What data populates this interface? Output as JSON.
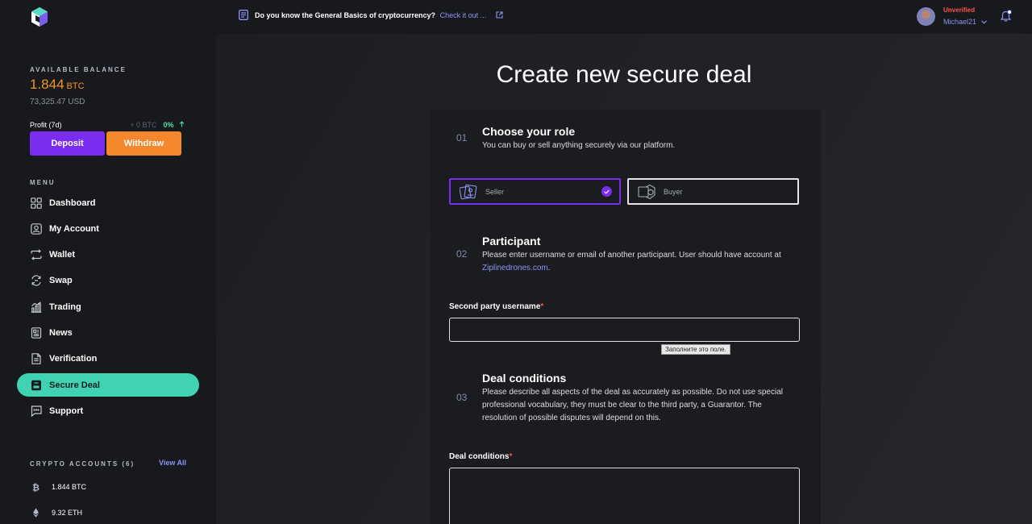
{
  "topbar": {
    "notice_text": "Do you know the General Basics of cryptocurrency?",
    "notice_link": "Check it out ...",
    "user_status": "Unverified",
    "username": "Michael21"
  },
  "sidebar": {
    "balance_label": "AVAILABLE BALANCE",
    "balance_amount": "1.844",
    "balance_unit": "BTC",
    "balance_usd": "73,325.47 USD",
    "profit_label": "Profit (7d)",
    "profit_btc": "+ 0 BTC",
    "profit_pct": "0%",
    "deposit_label": "Deposit",
    "withdraw_label": "Withdraw",
    "menu_label": "MENU",
    "menu": [
      {
        "label": "Dashboard",
        "icon": "grid-icon"
      },
      {
        "label": "My Account",
        "icon": "user-icon"
      },
      {
        "label": "Wallet",
        "icon": "swap-arrows-icon"
      },
      {
        "label": "Swap",
        "icon": "exchange-icon"
      },
      {
        "label": "Trading",
        "icon": "chart-icon"
      },
      {
        "label": "News",
        "icon": "news-icon"
      },
      {
        "label": "Verification",
        "icon": "document-icon"
      },
      {
        "label": "Secure Deal",
        "icon": "deal-icon",
        "active": true
      },
      {
        "label": "Support",
        "icon": "chat-icon"
      }
    ],
    "crypto_label": "CRYPTO ACCOUNTS (6)",
    "view_all": "View All",
    "crypto": [
      {
        "label": "1.844 BTC",
        "icon": "bitcoin-icon"
      },
      {
        "label": "9.32 ETH",
        "icon": "ethereum-icon"
      }
    ]
  },
  "main": {
    "title": "Create new secure deal",
    "step1": {
      "num": "01",
      "title": "Choose your role",
      "desc": "You can buy or sell anything securely via our platform.",
      "seller": "Seller",
      "buyer": "Buyer"
    },
    "step2": {
      "num": "02",
      "title": "Participant",
      "desc": "Please enter username or email of another participant. User should have account at",
      "link": "Ziplinedrones.com",
      "link_suffix": "."
    },
    "second_party_label": "Second party username",
    "required_mark": "*",
    "tooltip": "Заполните это поле.",
    "step3": {
      "num": "03",
      "title": "Deal conditions",
      "desc": "Please describe all aspects of the deal as accurately as possible. Do not use special professional vocabulary, they must be clear to the third party, a Guarantor. The resolution of possible disputes will depend on this."
    },
    "deal_conditions_label": "Deal conditions"
  },
  "colors": {
    "accent_purple": "#7a2cef",
    "accent_orange": "#f5872c",
    "active_teal": "#3fd3b2",
    "link_blue": "#8d93f5",
    "status_red": "#ff4f4a"
  }
}
